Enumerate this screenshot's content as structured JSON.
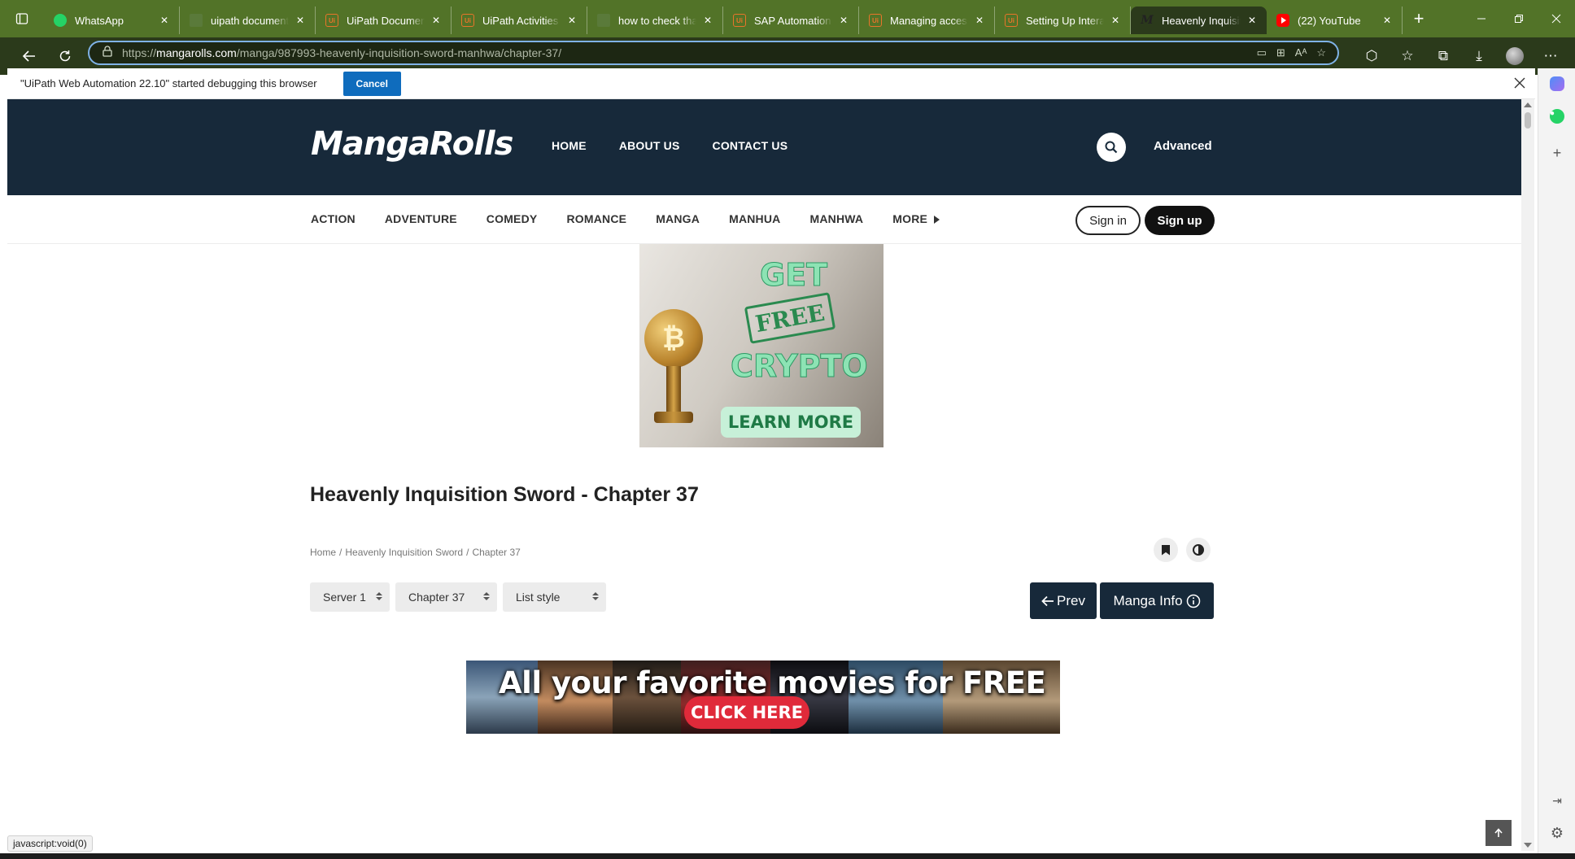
{
  "browser": {
    "tabs": [
      {
        "title": "WhatsApp",
        "favicon": "whatsapp-icon"
      },
      {
        "title": "uipath documentati",
        "favicon": "document-icon"
      },
      {
        "title": "UiPath Document U",
        "favicon": "uipath-icon"
      },
      {
        "title": "UiPath Activities",
        "favicon": "uipath-icon"
      },
      {
        "title": "how to check that c",
        "favicon": "document-icon"
      },
      {
        "title": "SAP Automation to",
        "favicon": "uipath-icon"
      },
      {
        "title": "Managing access a",
        "favicon": "uipath-icon"
      },
      {
        "title": "Setting Up Interact",
        "favicon": "uipath-icon"
      },
      {
        "title": "Heavenly Inquisitio",
        "favicon": "mangarolls-icon",
        "active": true
      },
      {
        "title": "(22) YouTube",
        "favicon": "youtube-icon"
      }
    ],
    "url_prefix": "https://",
    "url_host": "mangarolls.com",
    "url_path": "/manga/987993-heavenly-inquisition-sword-manhwa/chapter-37/",
    "accent_color": "#527328"
  },
  "infobar": {
    "message": "\"UiPath Web Automation 22.10\" started debugging this browser",
    "cancel_label": "Cancel"
  },
  "site": {
    "logo": "MangaRolls",
    "nav": {
      "home": "HOME",
      "about": "ABOUT US",
      "contact": "CONTACT US"
    },
    "advanced": "Advanced",
    "genres": [
      "ACTION",
      "ADVENTURE",
      "COMEDY",
      "ROMANCE",
      "MANGA",
      "MANHUA",
      "MANHWA"
    ],
    "more": "MORE",
    "signin": "Sign in",
    "signup": "Sign up",
    "header_color": "#17293a"
  },
  "ads": {
    "crypto": {
      "line1": "GET",
      "stamp": "FREE",
      "line2": "CRYPTO",
      "cta": "LEARN MORE",
      "coin_symbol": "₿"
    },
    "movies": {
      "headline": "All your favorite movies for FREE",
      "cta": "CLICK HERE"
    }
  },
  "chapter": {
    "title": "Heavenly Inquisition Sword - Chapter 37",
    "breadcrumb": [
      "Home",
      "Heavenly Inquisition Sword",
      "Chapter 37"
    ],
    "server_select": "Server 1",
    "chapter_select": "Chapter 37",
    "style_select": "List style",
    "prev_label": "Prev",
    "info_label": "Manga Info"
  },
  "statusbar": {
    "link": "javascript:void(0)"
  }
}
